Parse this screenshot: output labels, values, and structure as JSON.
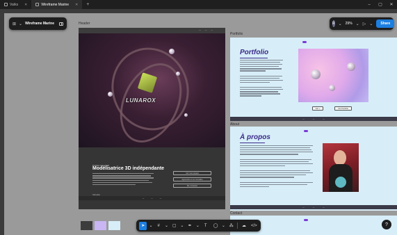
{
  "titlebar": {
    "tabs": [
      {
        "label": "Vaïks",
        "active": false
      },
      {
        "label": "Wireframe Marine",
        "active": true
      }
    ],
    "new_tab": "+",
    "controls": [
      "–",
      "▢",
      "✕"
    ]
  },
  "project": {
    "name": "Wireframe Marine",
    "menu_icon": "figma-menu-icon",
    "sidebar_icon": "sidebar-toggle-icon"
  },
  "share_panel": {
    "avatar_initial": "R",
    "zoom": "29%",
    "play_icon": "play-icon",
    "share_label": "Share"
  },
  "frames": {
    "header_label": "Header",
    "portfolio_label": "Portfolio",
    "about_label": "About",
    "contact_label": "Contact"
  },
  "header": {
    "hero_logo": "LUNAROX",
    "subtitle_small": "Portfolio Ciara Wall",
    "title": "Modélisatrice 3D indépendante",
    "buttons": [
      "Voir mes projets",
      "Apprendre à me connaître",
      "Me contacter"
    ],
    "link": "Voir plus"
  },
  "portfolio": {
    "title": "Portfolio",
    "buttons": [
      "Voir +",
      "Voir Portfolio"
    ]
  },
  "about": {
    "title": "À propos"
  },
  "swatches": [
    "#3c3c3c",
    "#c9b6f3",
    "#d7eef8"
  ],
  "toolbar": {
    "tools": [
      "move-tool-icon",
      "frame-tool-icon",
      "rectangle-tool-icon",
      "pen-tool-icon",
      "text-tool-icon",
      "comment-tool-icon",
      "actions-icon",
      "dev-mode-icon",
      "code-icon"
    ]
  },
  "help_label": "?"
}
